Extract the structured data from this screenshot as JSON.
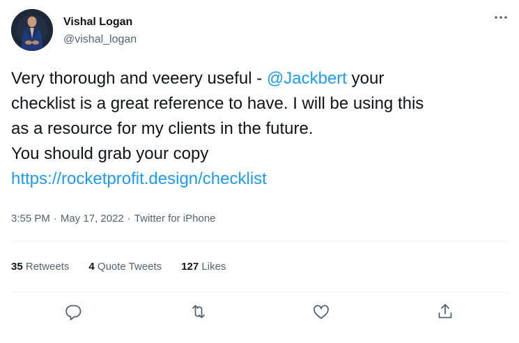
{
  "author": {
    "display_name": "Vishal Logan",
    "handle": "@vishal_logan"
  },
  "tweet": {
    "text_line1_before_mention": "Very thorough and veeery useful - ",
    "mention": "@Jackbert",
    "text_line1_after_mention": " your",
    "text_rest": "checklist is a great reference to have. I will be using this\nas a resource for my clients in the future.\nYou should grab your copy\n",
    "url": "https://rocketprofit.design/checklist"
  },
  "meta": {
    "time": "3:55 PM",
    "separator": "·",
    "date": "May 17, 2022",
    "source": "Twitter for iPhone"
  },
  "stats": {
    "retweets_count": "35",
    "retweets_label": "Retweets",
    "quotes_count": "4",
    "quotes_label": "Quote Tweets",
    "likes_count": "127",
    "likes_label": "Likes"
  },
  "icons": {
    "more": "more-options-icon",
    "reply": "reply-icon",
    "retweet": "retweet-icon",
    "like": "like-icon",
    "share": "share-icon"
  },
  "colors": {
    "accent": "#1d9bf0",
    "text": "#0f1419",
    "secondary": "#536471",
    "divider": "#eff3f4"
  }
}
